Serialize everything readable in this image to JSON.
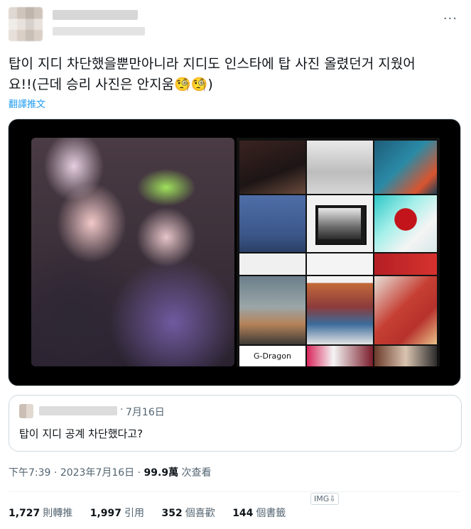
{
  "header": {
    "more_icon": "more-icon"
  },
  "tweet": {
    "text_line1": "탑이 지디 차단했을뿐만아니라 지디도 인스타에 탑 사진 올렸던거 지웠어",
    "text_line2": "요!!(근데 승리 사진은 안지움🧐🧐)",
    "translate_label": "翻譯推文"
  },
  "media": {
    "gd_label": "G-Dragon"
  },
  "quote": {
    "dot": "·",
    "date": "7月16日",
    "text": "탑이 지디 공계 차단했다고?"
  },
  "meta": {
    "time": "下午7:39",
    "sep1": " · ",
    "date": "2023年7月16日",
    "sep2": " · ",
    "views_count": "99.9萬",
    "views_label": " 次查看"
  },
  "img_tag": "IMG⇩",
  "stats": [
    {
      "count": "1,727",
      "label": "則轉推"
    },
    {
      "count": "1,997",
      "label": "引用"
    },
    {
      "count": "352",
      "label": "個喜歡"
    },
    {
      "count": "144",
      "label": "個書籤"
    }
  ],
  "colors": {
    "link": "#1d9bf0",
    "muted": "#536471",
    "text": "#0f1419",
    "border": "#cfd9de"
  }
}
